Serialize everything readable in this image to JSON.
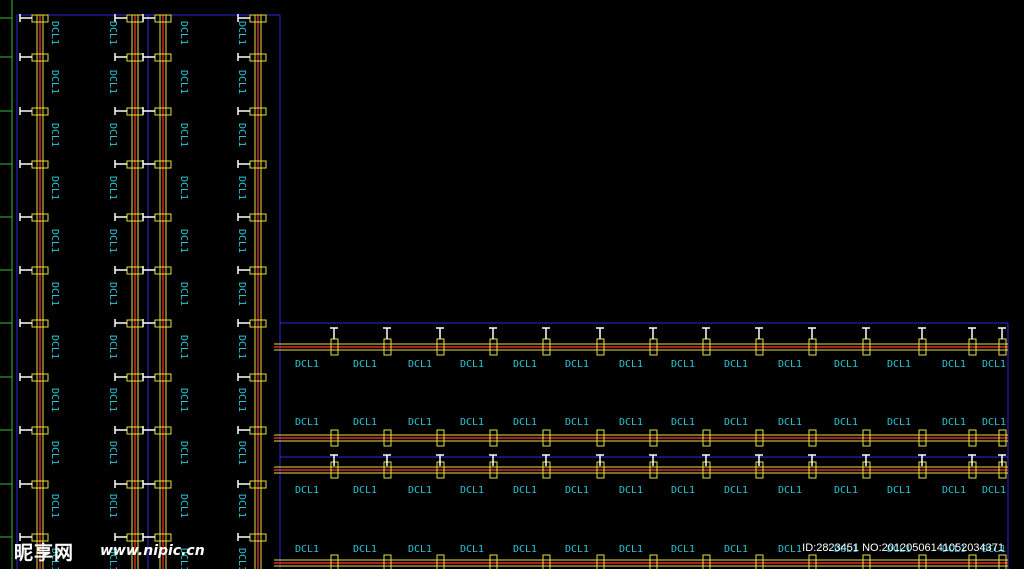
{
  "drawing": {
    "label_text": "DCL1",
    "colors": {
      "background": "#000000",
      "frame": "#2a2ae0",
      "beam_red": "#e02b2b",
      "beam_yellow": "#e8e03a",
      "label": "#27c6d6",
      "bracket": "#ffffff",
      "axis_tick": "#2fbf3a"
    }
  },
  "watermark": {
    "logo": "昵享网",
    "url": "www.nipic.cn",
    "id_line": "ID:2823451 NO:20120506141052034371"
  }
}
